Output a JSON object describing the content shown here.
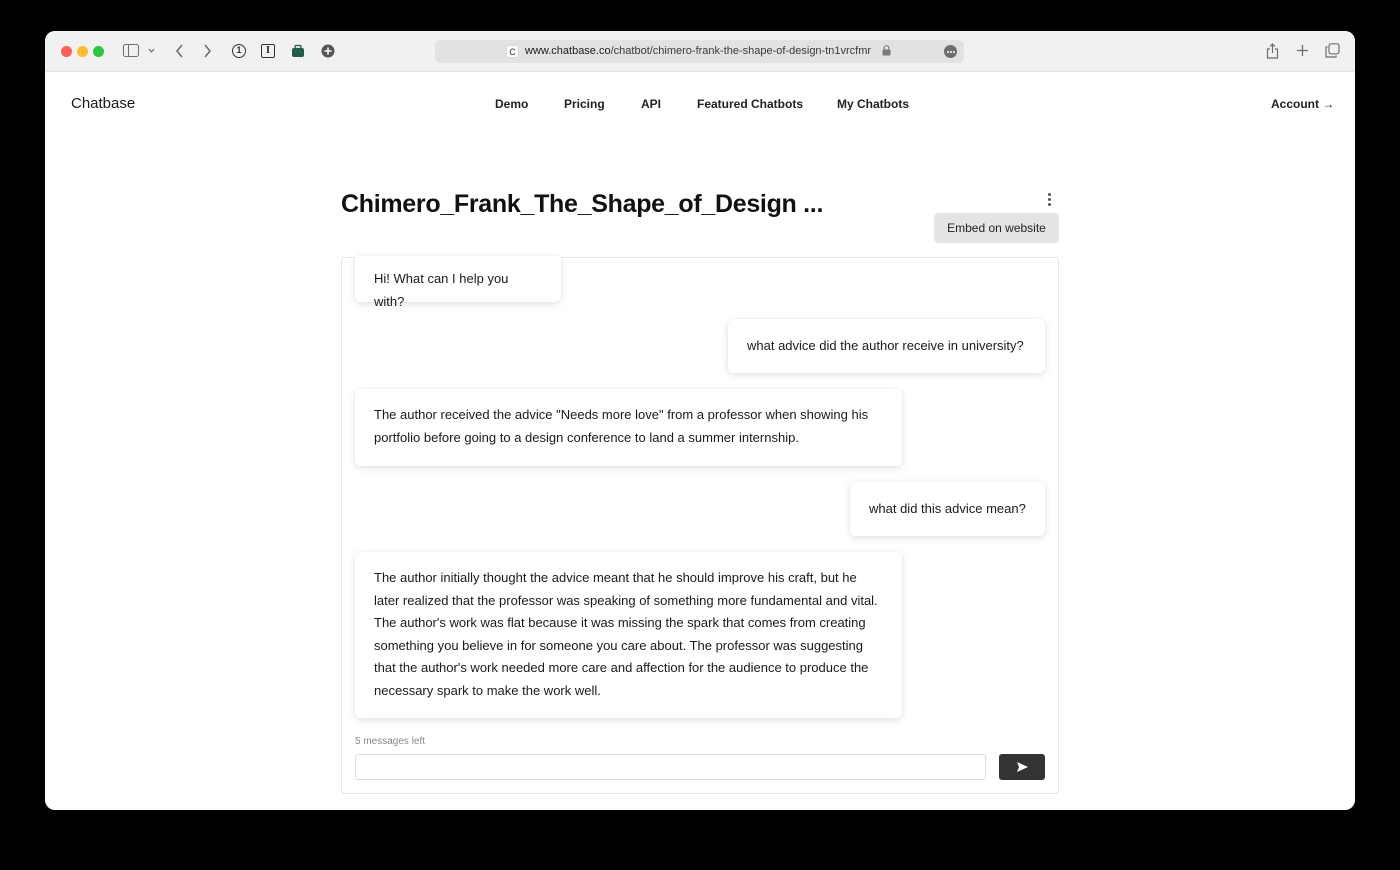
{
  "browser": {
    "url_domain": "www.chatbase.co",
    "url_path": "/chatbot/chimero-frank-the-shape-of-design-tn1vrcfmr",
    "favicon_letter": "C",
    "extension_icon_1": "1",
    "extension_icon_2": "I"
  },
  "header": {
    "brand": "Chatbase",
    "nav": [
      "Demo",
      "Pricing",
      "API",
      "Featured Chatbots",
      "My Chatbots"
    ],
    "account": "Account →"
  },
  "chatbot": {
    "title": "Chimero_Frank_The_Shape_of_Design ...",
    "embed_button": "Embed on website"
  },
  "chat": {
    "messages": [
      {
        "role": "bot",
        "text": "Hi! What can I help you with?"
      },
      {
        "role": "user",
        "text": "what advice did the author receive in university?"
      },
      {
        "role": "bot",
        "text": "The author received the advice \"Needs more love\" from a professor when showing his portfolio before going to a design conference to land a summer internship."
      },
      {
        "role": "user",
        "text": "what did this advice mean?"
      },
      {
        "role": "bot",
        "text": "The author initially thought the advice meant that he should improve his craft, but he later realized that the professor was speaking of something more fundamental and vital. The author's work was flat because it was missing the spark that comes from creating something you believe in for someone you care about. The professor was suggesting that the author's work needed more care and affection for the audience to produce the necessary spark to make the work well."
      }
    ],
    "messages_left": "5 messages left",
    "input_value": "",
    "send_icon": "send-arrow"
  },
  "colors": {
    "traffic_red": "#fe5f57",
    "traffic_yellow": "#febc2e",
    "traffic_green": "#28c840",
    "send_button": "#333333",
    "embed_button_bg": "#e4e4e7"
  }
}
